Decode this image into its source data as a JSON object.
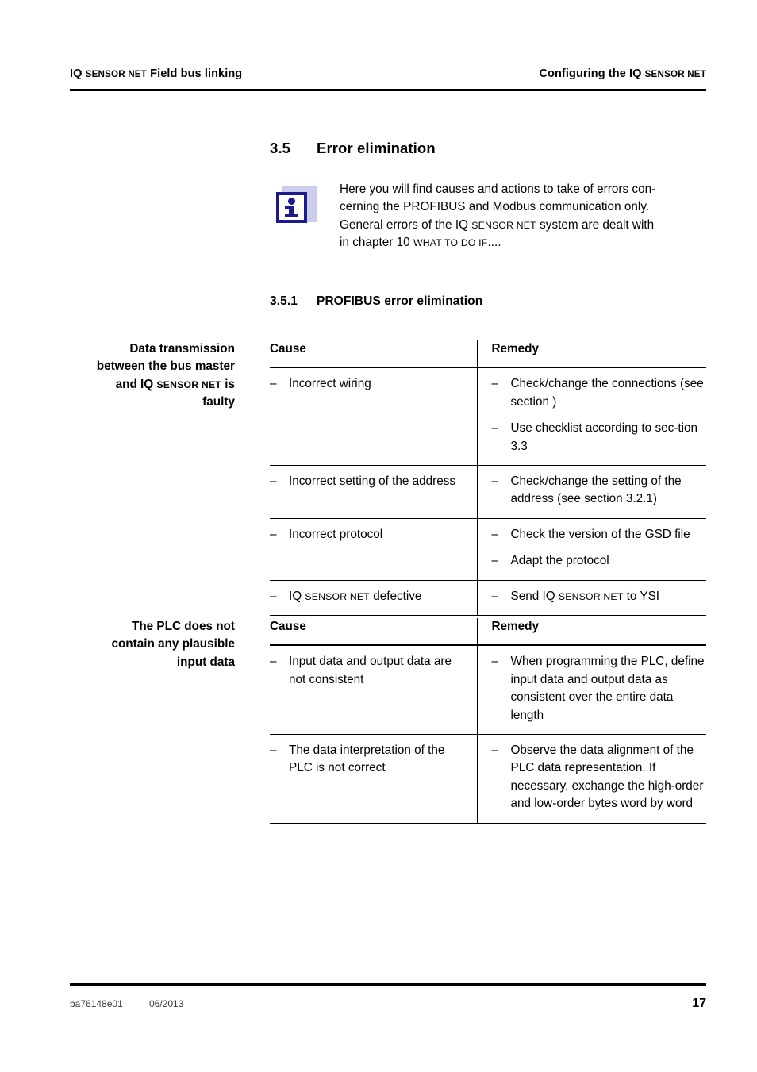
{
  "header": {
    "left_prefix": "IQ ",
    "left_smallcaps": "SENSOR NET",
    "left_suffix": " Field bus linking",
    "right_prefix": "Configuring the IQ ",
    "right_smallcaps": "SENSOR NET"
  },
  "section": {
    "number": "3.5",
    "title": "Error elimination"
  },
  "note": {
    "icon": "info-icon",
    "line1": "Here you will find causes and actions to take of errors con-",
    "line2": "cerning the PROFIBUS and Modbus communication only.",
    "line3_a": "General errors of the IQ ",
    "line3_sc": "SENSOR NET",
    "line3_b": " system are dealt with",
    "line4_a": "in chapter 10 ",
    "line4_sc": "WHAT TO DO IF",
    "line4_b": "...."
  },
  "subsection": {
    "number": "3.5.1",
    "title": "PROFIBUS error elimination"
  },
  "sidenotes": {
    "first": {
      "line1": "Data transmission",
      "line2": "between the bus master",
      "line3_a": "and IQ ",
      "line3_sc": "SENSOR NET",
      "line3_b": " is",
      "line4": "faulty"
    },
    "second": {
      "line1": "The PLC does not",
      "line2": "contain any plausible",
      "line3": "input data"
    }
  },
  "tables": [
    {
      "id": "profibus-error-table",
      "headers": {
        "cause": "Cause",
        "remedy": "Remedy"
      },
      "rows": [
        {
          "cause": [
            {
              "text": "Incorrect wiring"
            }
          ],
          "remedy": [
            {
              "text": "Check/change the connections (see section )"
            },
            {
              "text": "Use checklist according to sec-tion 3.3"
            }
          ]
        },
        {
          "cause": [
            {
              "text": "Incorrect setting of the address"
            }
          ],
          "remedy": [
            {
              "text": "Check/change the setting of the address (see section 3.2.1)"
            }
          ]
        },
        {
          "cause": [
            {
              "text": "Incorrect protocol"
            }
          ],
          "remedy": [
            {
              "text": "Check the version of the GSD file"
            },
            {
              "text": "Adapt the protocol"
            }
          ]
        },
        {
          "cause": [
            {
              "pre": "IQ ",
              "sc": "SENSOR NET",
              "post": " defective"
            }
          ],
          "remedy": [
            {
              "pre": "Send IQ ",
              "sc": "SENSOR NET",
              "post": " to YSI"
            }
          ]
        }
      ]
    },
    {
      "id": "plc-input-data-table",
      "headers": {
        "cause": "Cause",
        "remedy": "Remedy"
      },
      "rows": [
        {
          "cause": [
            {
              "text": "Input data and output data are not consistent"
            }
          ],
          "remedy": [
            {
              "text": "When programming the PLC, define input data and output data as consistent over the entire data length"
            }
          ]
        },
        {
          "cause": [
            {
              "text": "The data interpretation of the PLC is not correct"
            }
          ],
          "remedy": [
            {
              "text": "Observe the data alignment of the PLC data representation. If necessary, exchange the high-order and low-order bytes word by word"
            }
          ]
        }
      ]
    }
  ],
  "footer": {
    "doc_id": "ba76148e01",
    "date": "06/2013",
    "page_number": "17"
  },
  "symbols": {
    "dash": "–"
  },
  "colors": {
    "icon_navy": "#1b1b8f",
    "icon_shadow": "#ccccec",
    "rule": "#000000",
    "text": "#000000"
  }
}
